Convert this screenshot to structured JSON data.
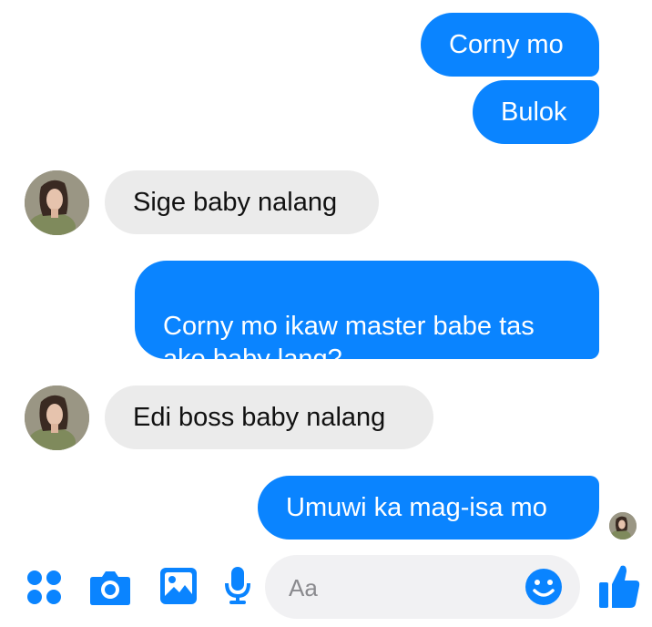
{
  "messages": [
    {
      "side": "sent",
      "text": "Corny mo"
    },
    {
      "side": "sent",
      "text": "Bulok"
    },
    {
      "side": "received",
      "text": "Sige baby nalang"
    },
    {
      "side": "sent",
      "text": "Corny mo ikaw master babe tas\nako baby lang?"
    },
    {
      "side": "received",
      "text": "Edi boss baby nalang"
    },
    {
      "side": "sent",
      "text": "Umuwi ka mag-isa mo"
    }
  ],
  "composer": {
    "placeholder": "Aa"
  },
  "toolbar": {
    "icons": [
      "apps-icon",
      "camera-icon",
      "gallery-icon",
      "microphone-icon",
      "emoji-icon",
      "like-thumbs-up-icon"
    ]
  },
  "colors": {
    "accent": "#0a84ff",
    "received_bubble": "#ebebeb",
    "composer_bg": "#f1f1f3"
  }
}
